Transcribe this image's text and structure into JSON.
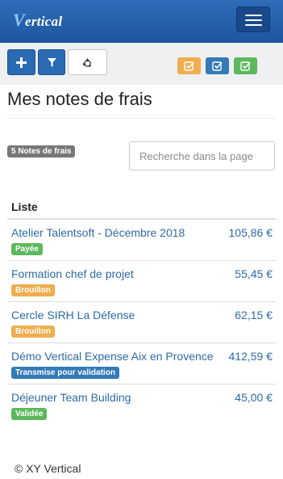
{
  "navbar": {
    "brand_initial": "V",
    "brand_rest": "ertical",
    "menu_icon": "hamburger-icon"
  },
  "toolbar": {
    "add_icon": "plus-icon",
    "filter_icon": "filter-icon",
    "recycle_icon": "recycle-icon",
    "status_buttons": [
      {
        "icon": "check-square-icon",
        "color": "#f0ad4e"
      },
      {
        "icon": "check-square-icon",
        "color": "#337ab7"
      },
      {
        "icon": "check-square-icon",
        "color": "#5cb85c"
      }
    ]
  },
  "page": {
    "title": "Mes notes de frais",
    "count_badge": "5 Notes de frais",
    "search_placeholder": "Recherche dans la page"
  },
  "list": {
    "header": "Liste",
    "items": [
      {
        "name": "Atelier Talentsoft - Décembre 2018",
        "amount": "105,86 €",
        "status": "Payée",
        "status_color": "#5cb85c"
      },
      {
        "name": "Formation chef de projet",
        "amount": "55,45 €",
        "status": "Brouillon",
        "status_color": "#f0ad4e"
      },
      {
        "name": "Cercle SIRH La Défense",
        "amount": "62,15 €",
        "status": "Brouillon",
        "status_color": "#f0ad4e"
      },
      {
        "name": "Démo Vertical Expense Aix en Provence",
        "amount": "412,59 €",
        "status": "Transmise pour validation",
        "status_color": "#337ab7"
      },
      {
        "name": "Déjeuner Team Building",
        "amount": "45,00 €",
        "status": "Validée",
        "status_color": "#5cb85c"
      }
    ]
  },
  "footer": {
    "text": "© XY Vertical"
  }
}
